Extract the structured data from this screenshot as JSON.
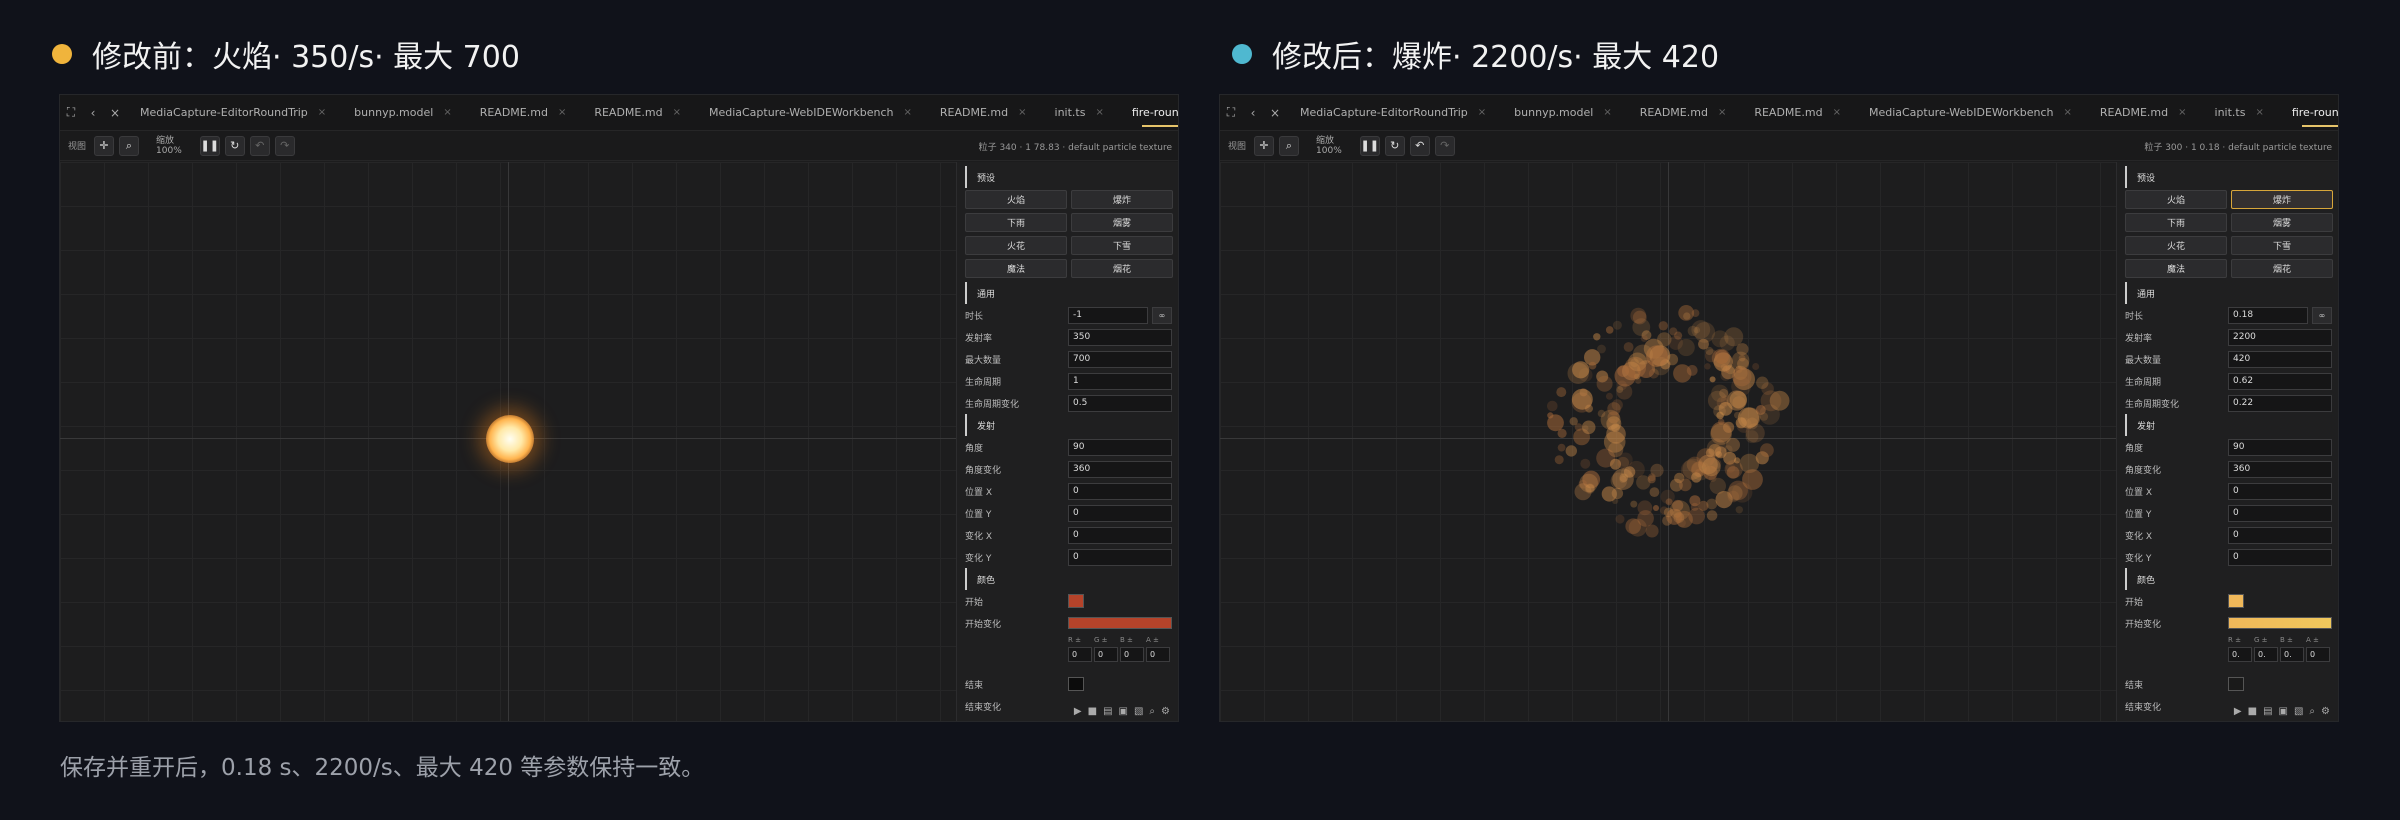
{
  "left": {
    "heading": "修改前：火焰· 350/s· 最大 700",
    "dot_color": "#f0b43c",
    "tabs": [
      "MediaCapture-EditorRoundTrip",
      "bunnyp.model",
      "README.md",
      "README.md",
      "MediaCapture-WebIDEWorkbench",
      "README.md",
      "init.ts",
      "fire-roundtrip.par"
    ],
    "toolbar": {
      "view": "视图",
      "zoom_label": "缩放",
      "zoom_value": "100%",
      "info": "粒子 340 · 1 78.83 · default particle texture"
    },
    "sections": {
      "presets": "预设",
      "general": "通用",
      "emission": "发射",
      "color": "颜色"
    },
    "presets": [
      "火焰",
      "爆炸",
      "下雨",
      "烟雾",
      "火花",
      "下雪",
      "魔法",
      "烟花"
    ],
    "selected_preset": "",
    "general_fields": [
      {
        "label": "时长",
        "value": "-1"
      },
      {
        "label": "发射率",
        "value": "350"
      },
      {
        "label": "最大数量",
        "value": "700"
      },
      {
        "label": "生命周期",
        "value": "1"
      },
      {
        "label": "生命周期变化",
        "value": "0.5"
      }
    ],
    "emission_fields": [
      {
        "label": "角度",
        "value": "90"
      },
      {
        "label": "角度变化",
        "value": "360"
      },
      {
        "label": "位置 X",
        "value": "0"
      },
      {
        "label": "位置 Y",
        "value": "0"
      },
      {
        "label": "变化 X",
        "value": "0"
      },
      {
        "label": "变化 Y",
        "value": "0"
      }
    ],
    "color": {
      "start_label": "开始",
      "start_color": "#b5432a",
      "variation_label": "开始变化",
      "variation_color": "#b5432a",
      "rgba_labels": [
        "R ±",
        "G ±",
        "B ±",
        "A ±"
      ],
      "rgba_values": [
        "0",
        "0",
        "0",
        "0"
      ],
      "end_label": "结束",
      "end_color": "#0c0c0c",
      "end_var_label": "结束变化"
    },
    "effect": "fire"
  },
  "right": {
    "heading": "修改后：爆炸· 2200/s· 最大 420",
    "dot_color": "#4fb8d0",
    "tabs": [
      "MediaCapture-EditorRoundTrip",
      "bunnyp.model",
      "README.md",
      "README.md",
      "MediaCapture-WebIDEWorkbench",
      "README.md",
      "init.ts",
      "fire-roundtrip.par"
    ],
    "toolbar": {
      "view": "视图",
      "zoom_label": "缩放",
      "zoom_value": "100%",
      "info": "粒子 300 · 1 0.18 · default particle texture"
    },
    "sections": {
      "presets": "预设",
      "general": "通用",
      "emission": "发射",
      "color": "颜色"
    },
    "presets": [
      "火焰",
      "爆炸",
      "下雨",
      "烟雾",
      "火花",
      "下雪",
      "魔法",
      "烟花"
    ],
    "selected_preset": "爆炸",
    "general_fields": [
      {
        "label": "时长",
        "value": "0.18"
      },
      {
        "label": "发射率",
        "value": "2200"
      },
      {
        "label": "最大数量",
        "value": "420"
      },
      {
        "label": "生命周期",
        "value": "0.62"
      },
      {
        "label": "生命周期变化",
        "value": "0.22"
      }
    ],
    "emission_fields": [
      {
        "label": "角度",
        "value": "90"
      },
      {
        "label": "角度变化",
        "value": "360"
      },
      {
        "label": "位置 X",
        "value": "0"
      },
      {
        "label": "位置 Y",
        "value": "0"
      },
      {
        "label": "变化 X",
        "value": "0"
      },
      {
        "label": "变化 Y",
        "value": "0"
      }
    ],
    "color": {
      "start_label": "开始",
      "start_color": "#f0b85a",
      "variation_label": "开始变化",
      "variation_color": "#f0c85c",
      "rgba_labels": [
        "R ±",
        "G ±",
        "B ±",
        "A ±"
      ],
      "rgba_values": [
        "0.",
        "0.",
        "0.",
        "0"
      ],
      "end_label": "结束",
      "end_color": "#1a1a1a",
      "end_var_label": "结束变化"
    },
    "effect": "explosion"
  },
  "footer": "保存并重开后，0.18 s、2200/s、最大 420 等参数保持一致。"
}
